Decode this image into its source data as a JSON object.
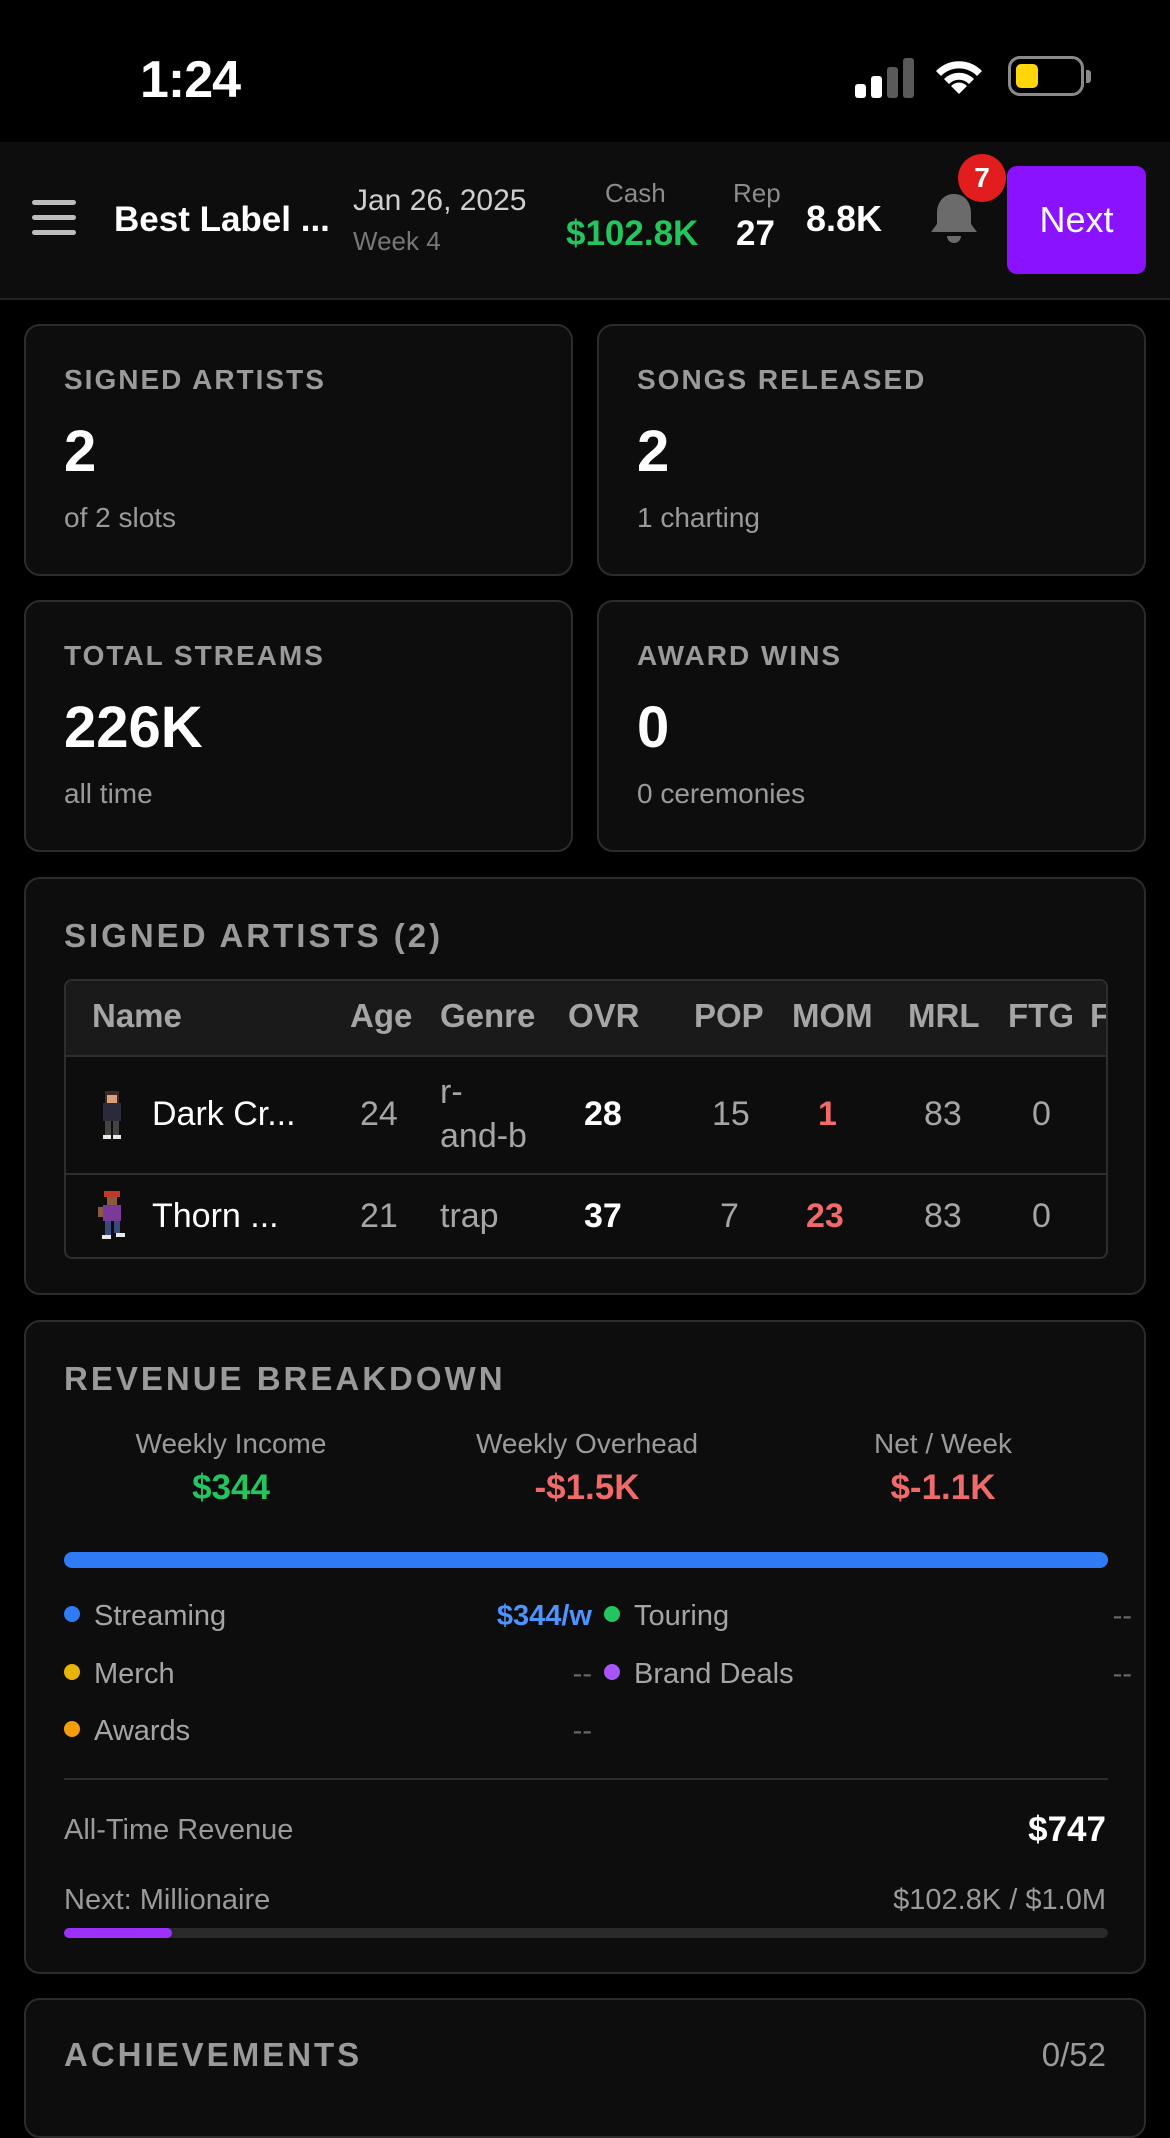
{
  "status_bar": {
    "time": "1:24"
  },
  "header": {
    "label_name": "Best Label ...",
    "date": "Jan 26, 2025",
    "week": "Week 4",
    "cash_label": "Cash",
    "cash_value": "$102.8K",
    "rep_label": "Rep",
    "rep_value": "27",
    "fans_value": "8.8K",
    "notification_count": "7",
    "next_label": "Next"
  },
  "stats": [
    {
      "label": "SIGNED ARTISTS",
      "value": "2",
      "sub": "of 2 slots"
    },
    {
      "label": "SONGS RELEASED",
      "value": "2",
      "sub": "1 charting"
    },
    {
      "label": "TOTAL STREAMS",
      "value": "226K",
      "sub": "all time"
    },
    {
      "label": "AWARD WINS",
      "value": "0",
      "sub": "0 ceremonies"
    }
  ],
  "artists": {
    "title": "SIGNED ARTISTS (2)",
    "columns": [
      "Name",
      "Age",
      "Genre",
      "OVR",
      "POP",
      "MOM",
      "MRL",
      "FTG",
      "F"
    ],
    "rows": [
      {
        "name": "Dark Cr...",
        "age": "24",
        "genre_line1": "r-",
        "genre_line2": "and-b",
        "ovr": "28",
        "pop": "15",
        "mom": "1",
        "mrl": "83",
        "ftg": "0"
      },
      {
        "name": "Thorn ...",
        "age": "21",
        "genre": "trap",
        "ovr": "37",
        "pop": "7",
        "mom": "23",
        "mrl": "83",
        "ftg": "0"
      }
    ]
  },
  "revenue": {
    "title": "REVENUE BREAKDOWN",
    "weekly_income_label": "Weekly Income",
    "weekly_income": "$344",
    "weekly_overhead_label": "Weekly Overhead",
    "weekly_overhead": "-$1.5K",
    "net_label": "Net / Week",
    "net": "$-1.1K",
    "streaming_share": 1.0,
    "legend": [
      {
        "name": "Streaming",
        "value": "$344/w",
        "color": "#2f7bf6"
      },
      {
        "name": "Touring",
        "value": "--",
        "color": "#22c55e"
      },
      {
        "name": "Merch",
        "value": "--",
        "color": "#eab308"
      },
      {
        "name": "Brand Deals",
        "value": "--",
        "color": "#a855f7"
      },
      {
        "name": "Awards",
        "value": "--",
        "color": "#f59e0b"
      }
    ],
    "all_time_label": "All-Time Revenue",
    "all_time_value": "$747",
    "next_milestone_label": "Next: Millionaire",
    "next_milestone_progress_text": "$102.8K / $1.0M",
    "next_milestone_progress": 0.103
  },
  "achievements": {
    "title": "ACHIEVEMENTS",
    "count": "0/52"
  },
  "colors": {
    "accent": "#8b12ff",
    "positive": "#22c55e",
    "negative": "#f06a6a",
    "badge": "#e11d1d"
  }
}
